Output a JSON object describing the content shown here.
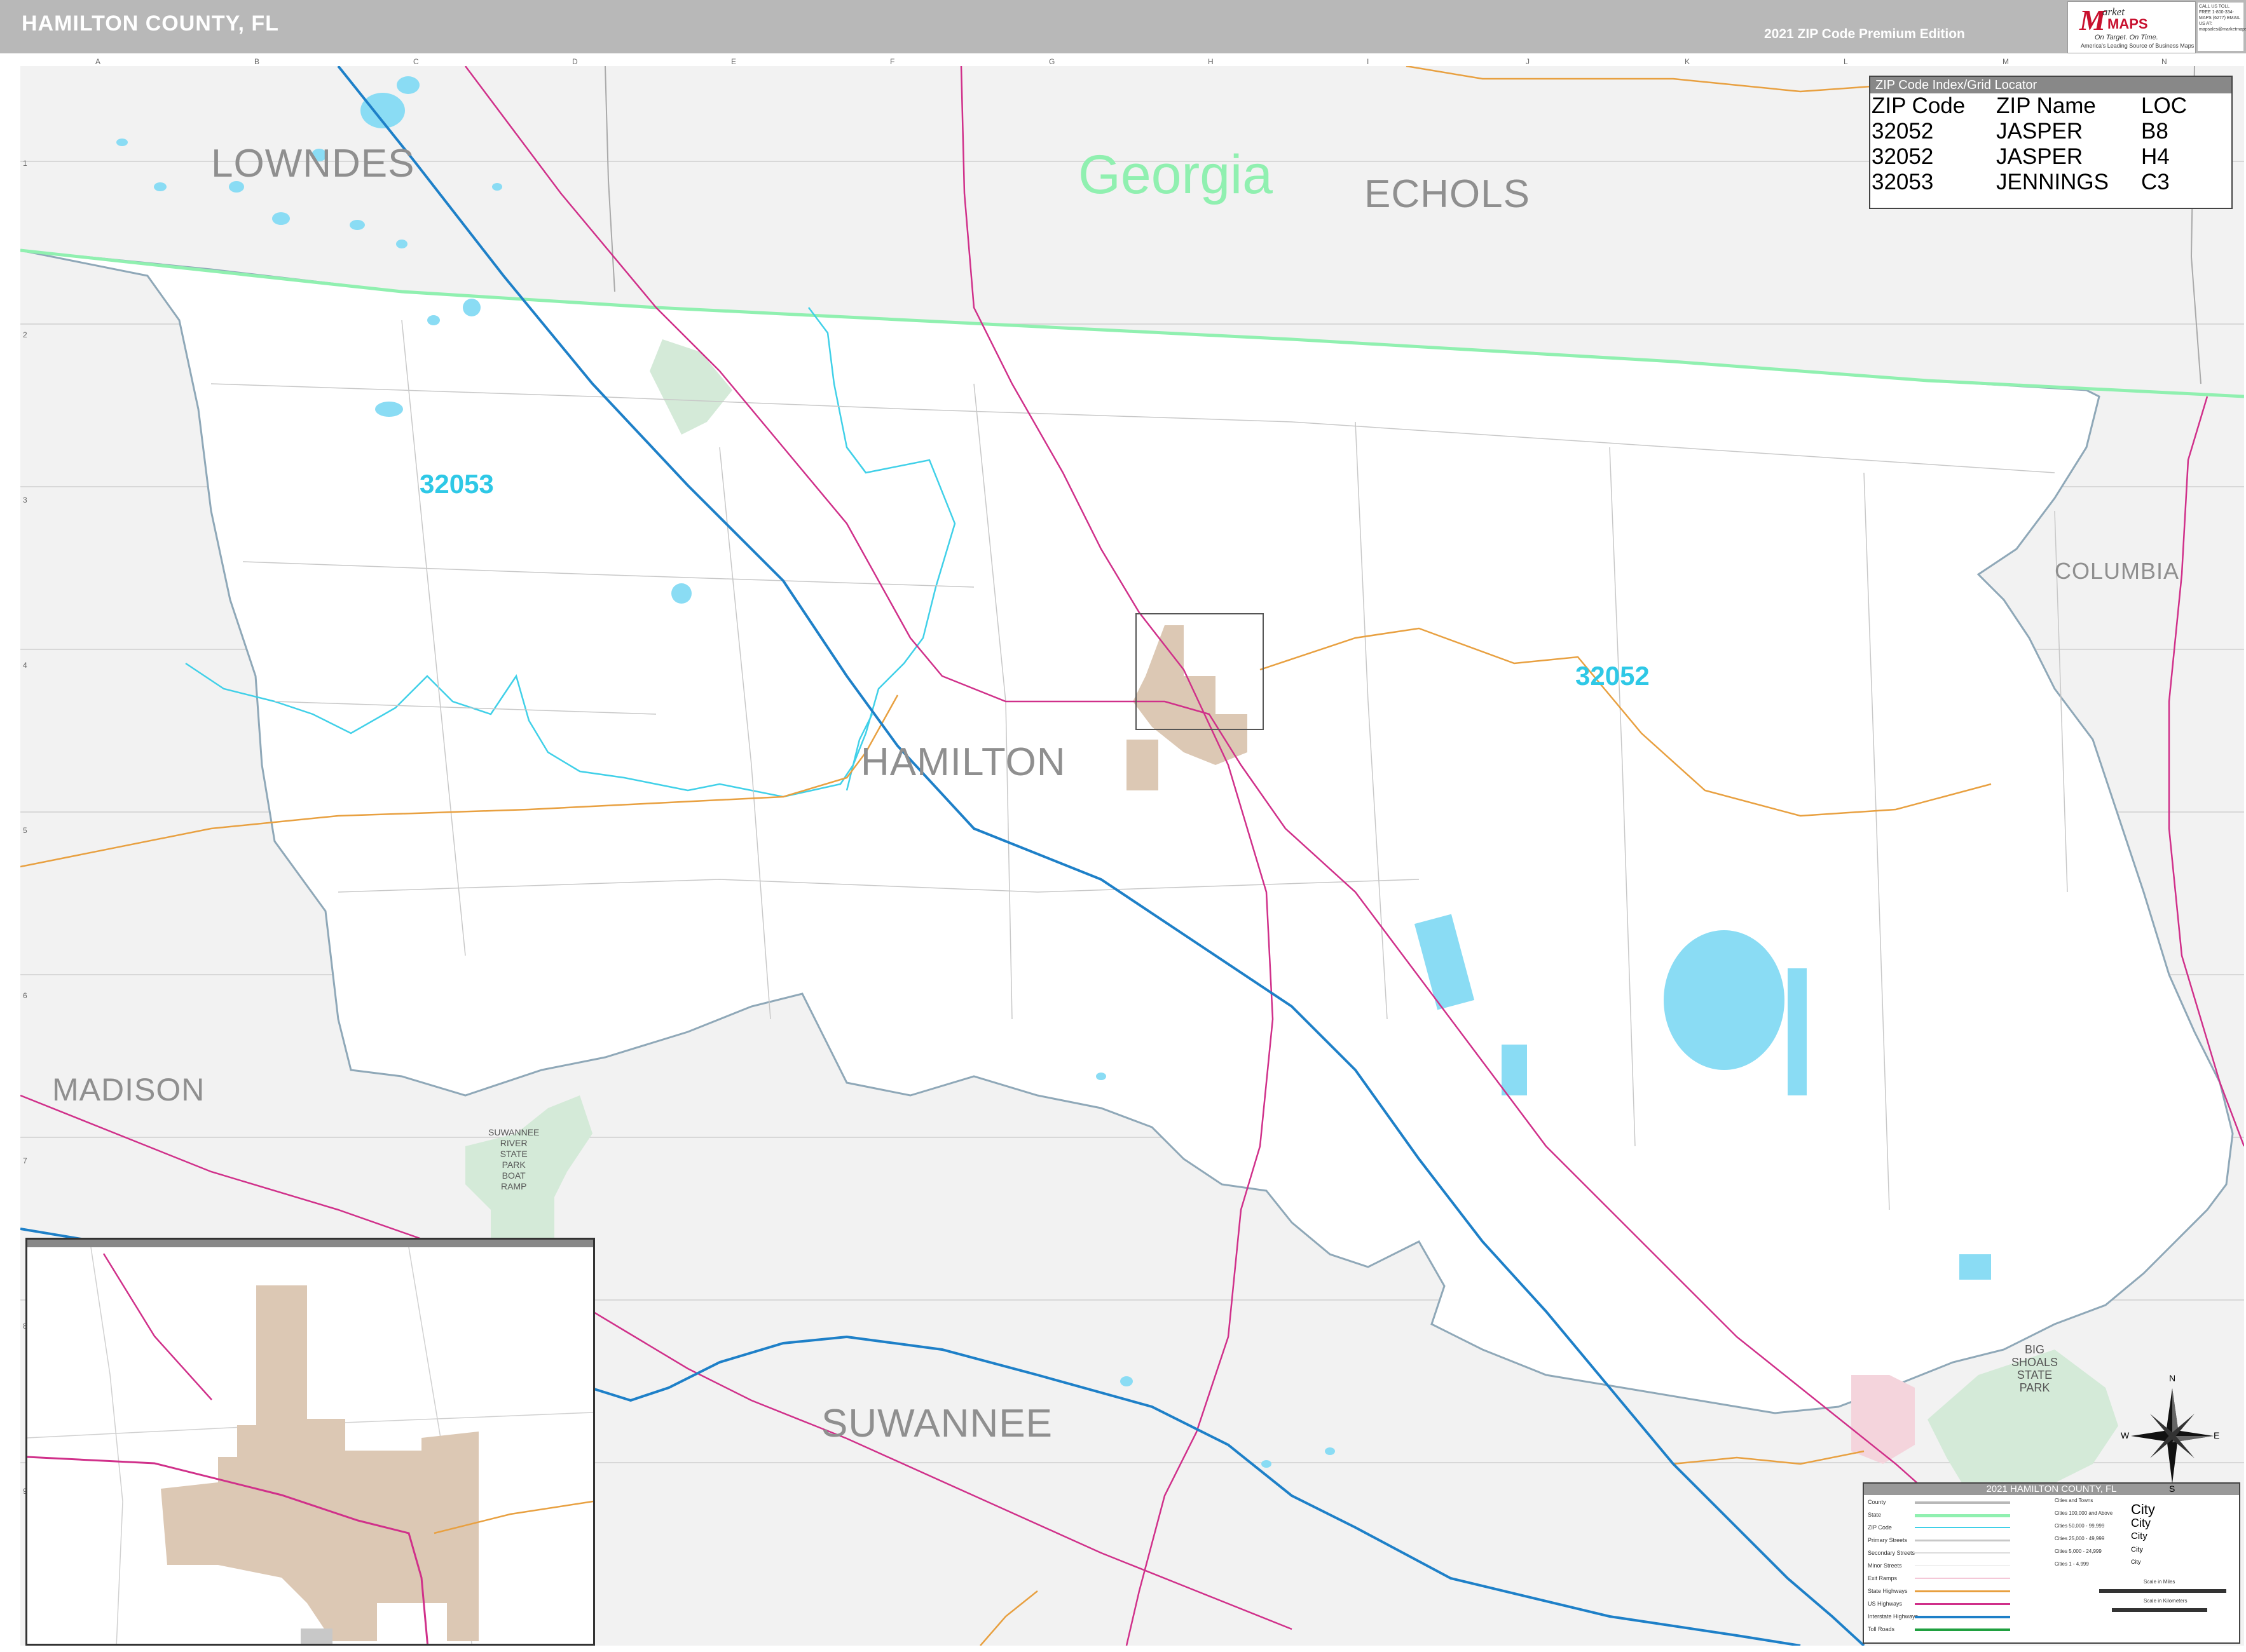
{
  "header": {
    "title": "HAMILTON COUNTY, FL",
    "edition": "2021 ZIP Code Premium Edition",
    "logo": {
      "brand_m": "M",
      "brand_arket": "arket",
      "brand_maps": "MAPS",
      "tagline": "On Target. On Time.",
      "subtagline": "America's Leading Source of Business Maps"
    },
    "contact_text": "CALL US TOLL FREE 1-800-334-MAPS (6277) EMAIL US AT: mapsales@marketmaps.com"
  },
  "grid": {
    "columns": [
      "A",
      "B",
      "C",
      "D",
      "E",
      "F",
      "G",
      "H",
      "I",
      "J",
      "K",
      "L",
      "M",
      "N"
    ],
    "rows": [
      "1",
      "2",
      "3",
      "4",
      "5",
      "6",
      "7",
      "8",
      "9"
    ]
  },
  "zip_index": {
    "caption": "ZIP Code Index/Grid Locator",
    "headers": [
      "ZIP Code",
      "ZIP Name",
      "LOC"
    ],
    "rows": [
      [
        "32052",
        "JASPER",
        "B8"
      ],
      [
        "32052",
        "JASPER",
        "H4"
      ],
      [
        "32053",
        "JENNINGS",
        "C3"
      ]
    ]
  },
  "labels": {
    "state": "Georgia",
    "counties": {
      "lowndes": "LOWNDES",
      "echols": "ECHOLS",
      "columbia": "COLUMBIA",
      "hamilton": "HAMILTON",
      "madison": "MADISON",
      "suwannee": "SUWANNEE"
    },
    "zips": {
      "z32053": "32053",
      "z32052": "32052"
    },
    "parks": {
      "suwannee": [
        "SUWANNEE",
        "RIVER",
        "STATE",
        "PARK",
        "BOAT",
        "RAMP"
      ],
      "big_shoals": [
        "BIG",
        "SHOALS",
        "STATE",
        "PARK"
      ]
    }
  },
  "legend": {
    "title": "2021 HAMILTON COUNTY, FL",
    "items": [
      "County",
      "State",
      "ZIP Code",
      "Primary Streets",
      "Secondary Streets",
      "Minor Streets",
      "Exit Ramps",
      "State Highways",
      "US Highways",
      "Interstate Highways",
      "Toll Roads"
    ],
    "cities_heading": "Cities and Towns",
    "city_classes": [
      "Cities 100,000 and Above",
      "Cities 50,000 - 99,999",
      "Cities 25,000 - 49,999",
      "Cities 5,000 - 24,999",
      "Cities 1 - 4,999"
    ],
    "city_samples": [
      "City",
      "City",
      "City",
      "City",
      "City"
    ],
    "scale_miles": "Scale in Miles",
    "scale_km": "Scale in Kilometers"
  },
  "compass": {
    "n": "N",
    "s": "S",
    "e": "E",
    "w": "W"
  },
  "colors": {
    "header_bg": "#b8b8b8",
    "map_bg": "#f2f2f2",
    "county_fill": "#ffffff",
    "state_line": "#90f0b0",
    "zip_line": "#40d0e8",
    "interstate": "#1e80c8",
    "us_highway": "#d0308a",
    "state_highway": "#e8a040",
    "water": "#8adcf4",
    "park": "#d4ead8",
    "city": "#dcc8b4"
  }
}
